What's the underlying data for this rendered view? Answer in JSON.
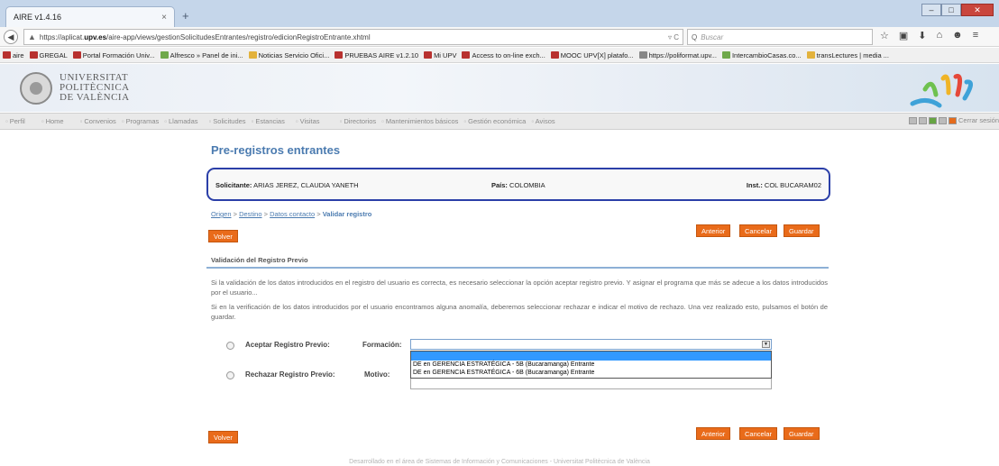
{
  "browser": {
    "tab_title": "AIRE v1.4.16",
    "tab_close": "×",
    "new_tab": "+",
    "url_prefix": "https://aplicat.",
    "url_domain": "upv.es",
    "url_path": "/aire-app/views/gestionSolicitudesEntrantes/registro/edicionRegistroEntrante.xhtml",
    "reload": "▿ C",
    "search_placeholder": "Buscar",
    "window_buttons": {
      "minimize": "–",
      "maximize": "□",
      "close": "✕"
    },
    "nav_icons": [
      "☆",
      "▣",
      "⬇",
      "⌂",
      "☻",
      "≡"
    ]
  },
  "bookmarks": [
    {
      "label": "aire",
      "icon": "upv-icon"
    },
    {
      "label": "GREGAL",
      "icon": "upv-icon"
    },
    {
      "label": "Portal Formación Univ...",
      "icon": "upv-icon"
    },
    {
      "label": "Alfresco » Panel de ini...",
      "icon": "alfresco-icon"
    },
    {
      "label": "Noticias Servicio Ofici...",
      "icon": "folder-icon"
    },
    {
      "label": "PRUEBAS AIRE v1.2.10",
      "icon": "upv-icon"
    },
    {
      "label": "Mi UPV",
      "icon": "upv-icon"
    },
    {
      "label": "Access to on-line exch...",
      "icon": "upv-icon"
    },
    {
      "label": "MOOC UPV[X] platafo...",
      "icon": "upv-icon"
    },
    {
      "label": "https://poliformat.upv...",
      "icon": "poliformat-icon"
    },
    {
      "label": "IntercambioCasas.co...",
      "icon": "location-icon"
    },
    {
      "label": "transLectures | media ...",
      "icon": "audio-icon"
    }
  ],
  "header": {
    "university_line1": "UNIVERSITAT",
    "university_line2": "POLITÈCNICA",
    "university_line3": "DE VALÈNCIA"
  },
  "menu": {
    "items": [
      "Perfil",
      "Home",
      "Convenios",
      "Programas",
      "Llamadas",
      "Solicitudes",
      "Estancias",
      "Visitas",
      "Directorios",
      "Mantenimientos básicos",
      "Gestión económica",
      "Avisos"
    ],
    "logout": "Cerrar sesión"
  },
  "page": {
    "title": "Pre-registros entrantes",
    "applicant": {
      "solicitante_label": "Solicitante:",
      "solicitante_value": "ARIAS JEREZ, CLAUDIA YANETH",
      "pais_label": "País:",
      "pais_value": "COLOMBIA",
      "inst_label": "Inst.:",
      "inst_value": "COL BUCARAM02"
    },
    "breadcrumb": {
      "origen": "Origen",
      "destino": "Destino",
      "datos_contacto": "Datos contacto",
      "separator": ">",
      "current": "Validar registro"
    },
    "buttons": {
      "volver": "Volver",
      "anterior": "Anterior",
      "cancelar": "Cancelar",
      "guardar": "Guardar"
    },
    "section_title": "Validación del Registro Previo",
    "paragraph1": "Si la validación de los datos introducidos en el registro del usuario es correcta, es necesario seleccionar la opción aceptar registro previo. Y asignar el programa que más se adecue a los datos introducidos por el usuario...",
    "paragraph2": "Si en la verificación de los datos introducidos por el usuario encontramos alguna anomalía, deberemos seleccionar rechazar e indicar el motivo de rechazo. Una vez realizado esto, pulsamos el botón de guardar.",
    "accept_label": "Aceptar Registro Previo:",
    "formacion_label": "Formación:",
    "reject_label": "Rechazar Registro Previo:",
    "motivo_label": "Motivo:",
    "formacion_selected": "",
    "formacion_options": [
      "",
      "DE en GERENCIA ESTRATÉGICA - 5B (Bucaramanga) Entrante",
      "DE en GERENCIA ESTRATÉGICA - 6B (Bucaramanga) Entrante"
    ],
    "footer": "Desarrollado en el área de Sistemas de Información y Comunicaciones - Universitat Politècnica de València"
  },
  "colors": {
    "accent_orange": "#e96b1a",
    "title_blue": "#4b7bb0",
    "highlight_box": "#2b3fa8",
    "dropdown_highlight": "#3399ff"
  }
}
